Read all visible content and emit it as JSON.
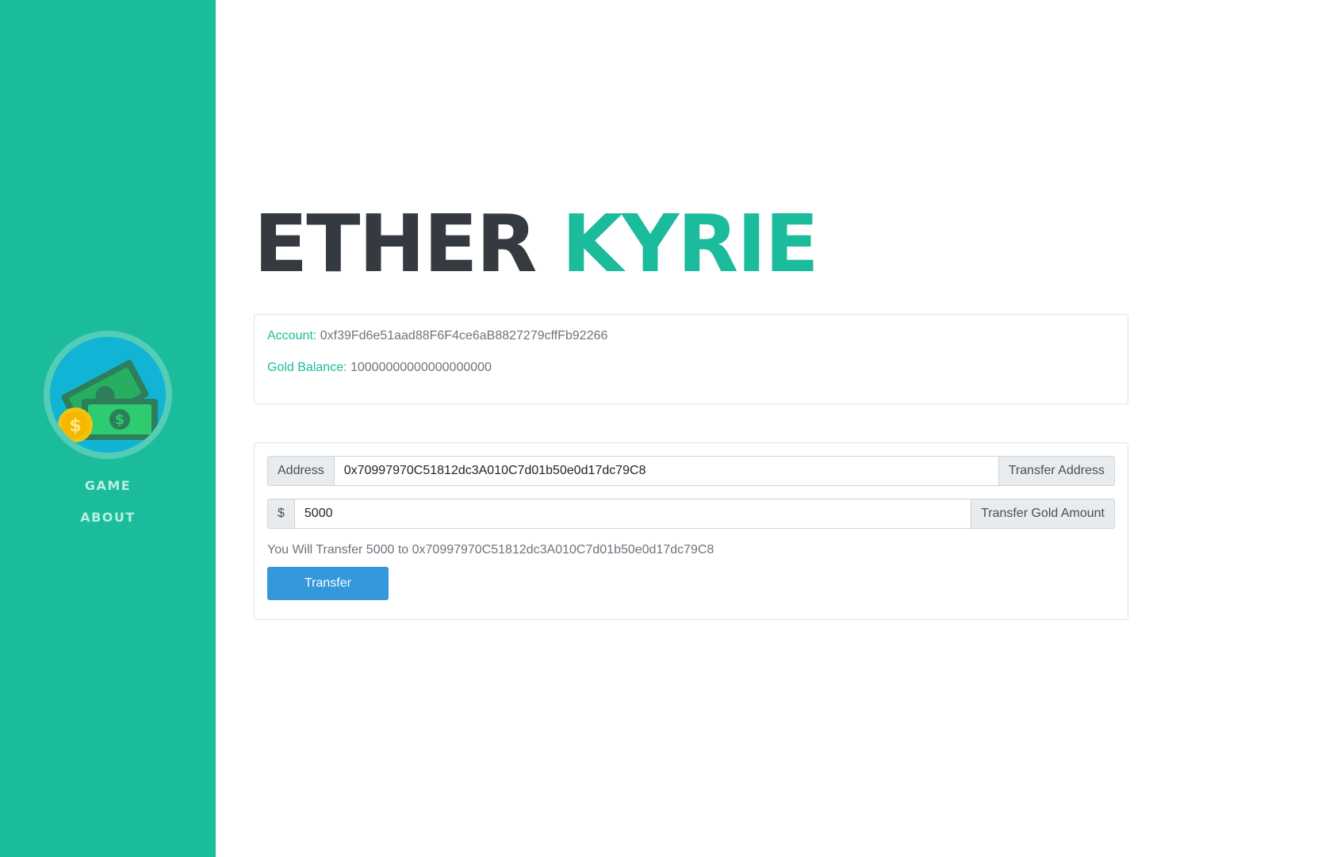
{
  "sidebar": {
    "logo_icon": "money-coin-icon",
    "nav": [
      {
        "label": "GAME"
      },
      {
        "label": "ABOUT"
      }
    ]
  },
  "header": {
    "title_part1": "ETHER",
    "title_part2": "KYRIE"
  },
  "account_info": {
    "account_label": "Account:",
    "account_value": "0xf39Fd6e51aad88F6F4ce6aB8827279cffFb92266",
    "balance_label": "Gold Balance:",
    "balance_value": "10000000000000000000"
  },
  "transfer": {
    "address_prefix": "Address",
    "address_value": "0x70997970C51812dc3A010C7d01b50e0d17dc79C8",
    "address_suffix": "Transfer Address",
    "amount_prefix": "$",
    "amount_value": "5000",
    "amount_suffix": "Transfer Gold Amount",
    "summary": "You Will Transfer 5000 to 0x70997970C51812dc3A010C7d01b50e0d17dc79C8",
    "button_label": "Transfer"
  },
  "colors": {
    "accent": "#1abc9c",
    "dark": "#343a40",
    "button": "#3498db"
  }
}
